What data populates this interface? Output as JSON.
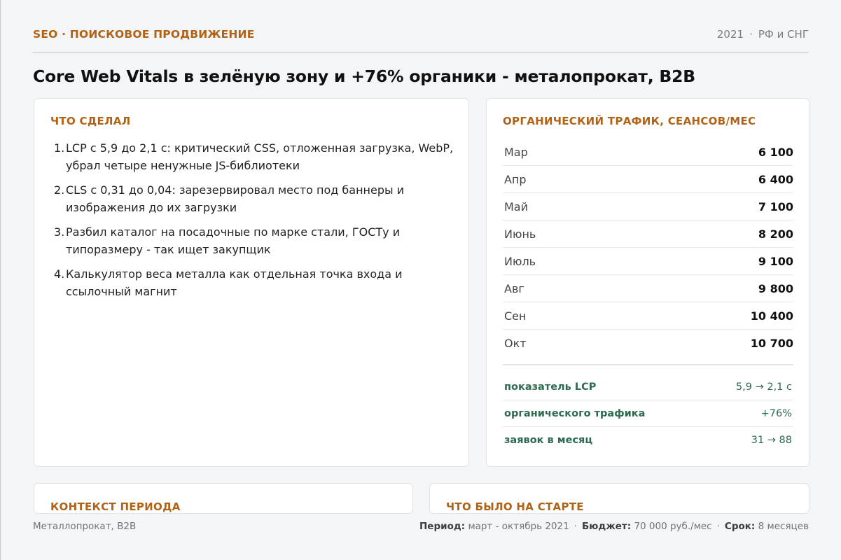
{
  "header": {
    "kicker": "SEO · ПОИСКОВОЕ ПРОДВИЖЕНИЕ",
    "year": "2021",
    "region": "РФ и СНГ"
  },
  "title": "Core Web Vitals в зелёную зону и +76% органики - металопрокат, B2B",
  "work": {
    "heading": "ЧТО СДЕЛАЛ",
    "steps": [
      {
        "num": "1.",
        "text": "LCP с 5,9 до 2,1 с: критический CSS, отложенная загрузка, WebP, убрал четыре ненужные JS-библиотеки"
      },
      {
        "num": "2.",
        "text": "CLS с 0,31 до 0,04: зарезервировал место под баннеры и изображения до их загрузки"
      },
      {
        "num": "3.",
        "text": "Разбил каталог на посадочные по марке стали, ГОСТу и типоразмеру - так ищет закупщик"
      },
      {
        "num": "4.",
        "text": "Калькулятор веса металла как отдельная точка входа и ссылочный магнит"
      }
    ]
  },
  "traffic": {
    "heading": "ОРГАНИЧЕСКИЙ ТРАФИК, СЕАНСОВ/МЕС",
    "rows": [
      {
        "month": "Мар",
        "value": "6 100"
      },
      {
        "month": "Апр",
        "value": "6 400"
      },
      {
        "month": "Май",
        "value": "7 100"
      },
      {
        "month": "Июнь",
        "value": "8 200"
      },
      {
        "month": "Июль",
        "value": "9 100"
      },
      {
        "month": "Авг",
        "value": "9 800"
      },
      {
        "month": "Сен",
        "value": "10 400"
      },
      {
        "month": "Окт",
        "value": "10 700"
      }
    ],
    "kpis": [
      {
        "label": "показатель LCP",
        "value": "5,9 → 2,1 с"
      },
      {
        "label": "органического трафика",
        "value": "+76%"
      },
      {
        "label": "заявок в месяц",
        "value": "31 → 88"
      }
    ]
  },
  "context": {
    "heading": "КОНТЕКСТ ПЕРИОДА"
  },
  "start": {
    "heading": "ЧТО БЫЛО НА СТАРТЕ"
  },
  "footer": {
    "client": "Металлопрокат, B2B",
    "period_label": "Период:",
    "period_value": "март - октябрь 2021",
    "budget_label": "Бюджет:",
    "budget_value": "70 000 руб./мес",
    "term_label": "Срок:",
    "term_value": "8 месяцев"
  },
  "colors": {
    "accent": "#b06216",
    "positive": "#2d6a4f",
    "background": "#f4f5f7"
  }
}
